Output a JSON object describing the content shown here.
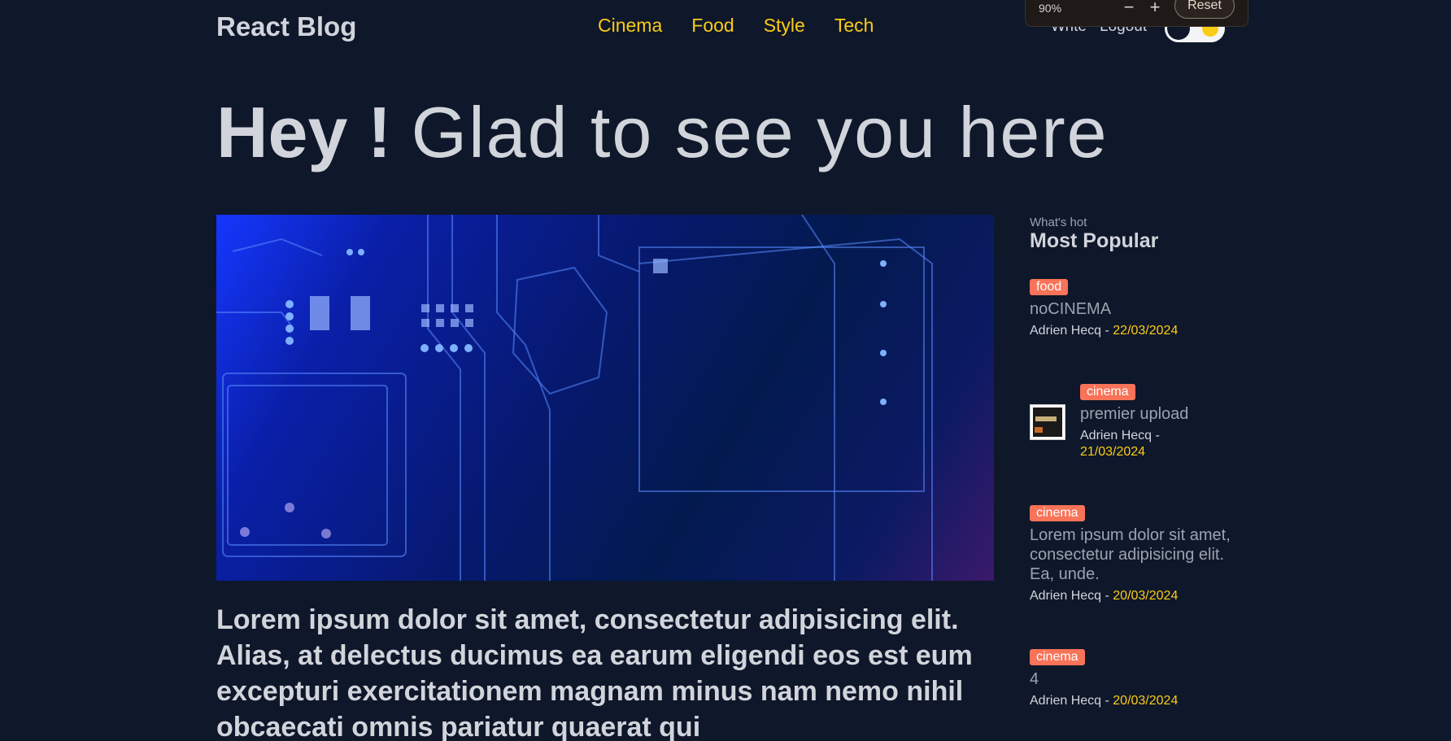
{
  "header": {
    "brand": "React Blog",
    "nav": [
      "Cinema",
      "Food",
      "Style",
      "Tech"
    ],
    "user_links": [
      "Write",
      "Logout"
    ]
  },
  "zoom": {
    "level": "90%",
    "minus": "−",
    "plus": "+",
    "reset": "Reset"
  },
  "hero": {
    "bold": "Hey !",
    "light": "Glad to see you here"
  },
  "featured": {
    "image": "circuit-board-image",
    "title": "Lorem ipsum dolor sit amet, consectetur adipisicing elit. Alias, at delectus ducimus ea earum eligendi eos est eum excepturi exercitationem magnam minus nam nemo nihil obcaecati omnis pariatur quaerat qui"
  },
  "sidebar": {
    "subtitle": "What's hot",
    "title": "Most Popular",
    "posts": [
      {
        "category": "food",
        "title": "noCINEMA",
        "author": "Adrien Hecq",
        "sep": " - ",
        "date": "22/03/2024"
      },
      {
        "category": "cinema",
        "title": "premier upload",
        "author": "Adrien Hecq",
        "sep": " -",
        "date": "21/03/2024"
      },
      {
        "category": "cinema",
        "title": "Lorem ipsum dolor sit amet, consectetur adipisicing elit. Ea, unde.",
        "author": "Adrien Hecq",
        "sep": " - ",
        "date": "20/03/2024"
      },
      {
        "category": "cinema",
        "title": "4",
        "author": "Adrien Hecq",
        "sep": " - ",
        "date": "20/03/2024"
      }
    ]
  },
  "colors": {
    "background": "#0f172a",
    "accent": "#facc15",
    "category_badge": "#f87358"
  }
}
